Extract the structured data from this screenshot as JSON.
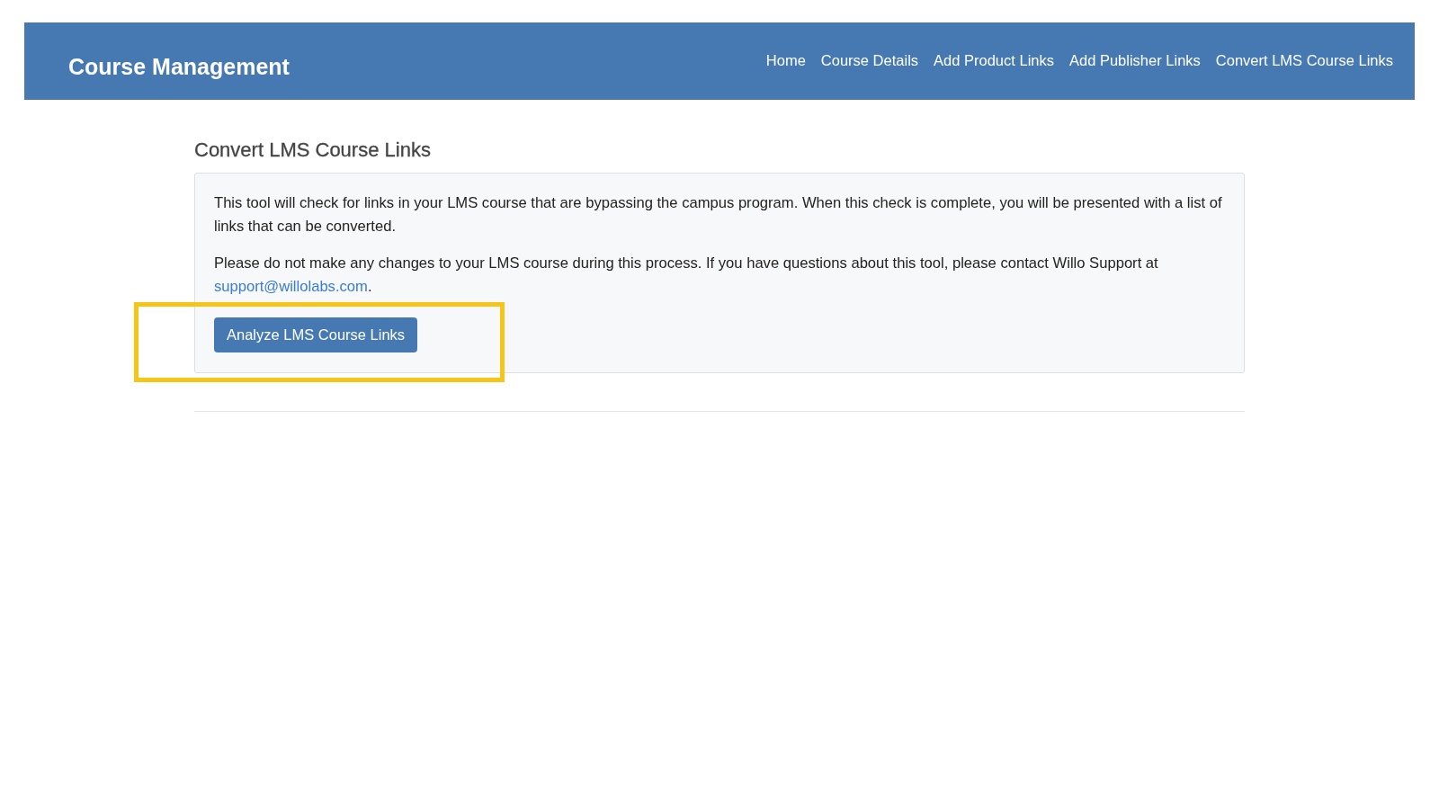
{
  "navbar": {
    "brand": "Course Management",
    "links": [
      "Home",
      "Course Details",
      "Add Product Links",
      "Add Publisher Links",
      "Convert LMS Course Links"
    ]
  },
  "page": {
    "heading": "Convert LMS Course Links",
    "paragraphs": [
      {
        "text": "This tool will check for links in your LMS course that are bypassing the campus program. When this check is complete, you will be presented with a list of links that can be converted."
      },
      {
        "text": "Please do not make any changes to your LMS course during this process. If you have questions about this tool, please contact Willo Support at ",
        "link": "support@willolabs.com",
        "after": "."
      }
    ],
    "button": "Analyze LMS Course Links"
  }
}
